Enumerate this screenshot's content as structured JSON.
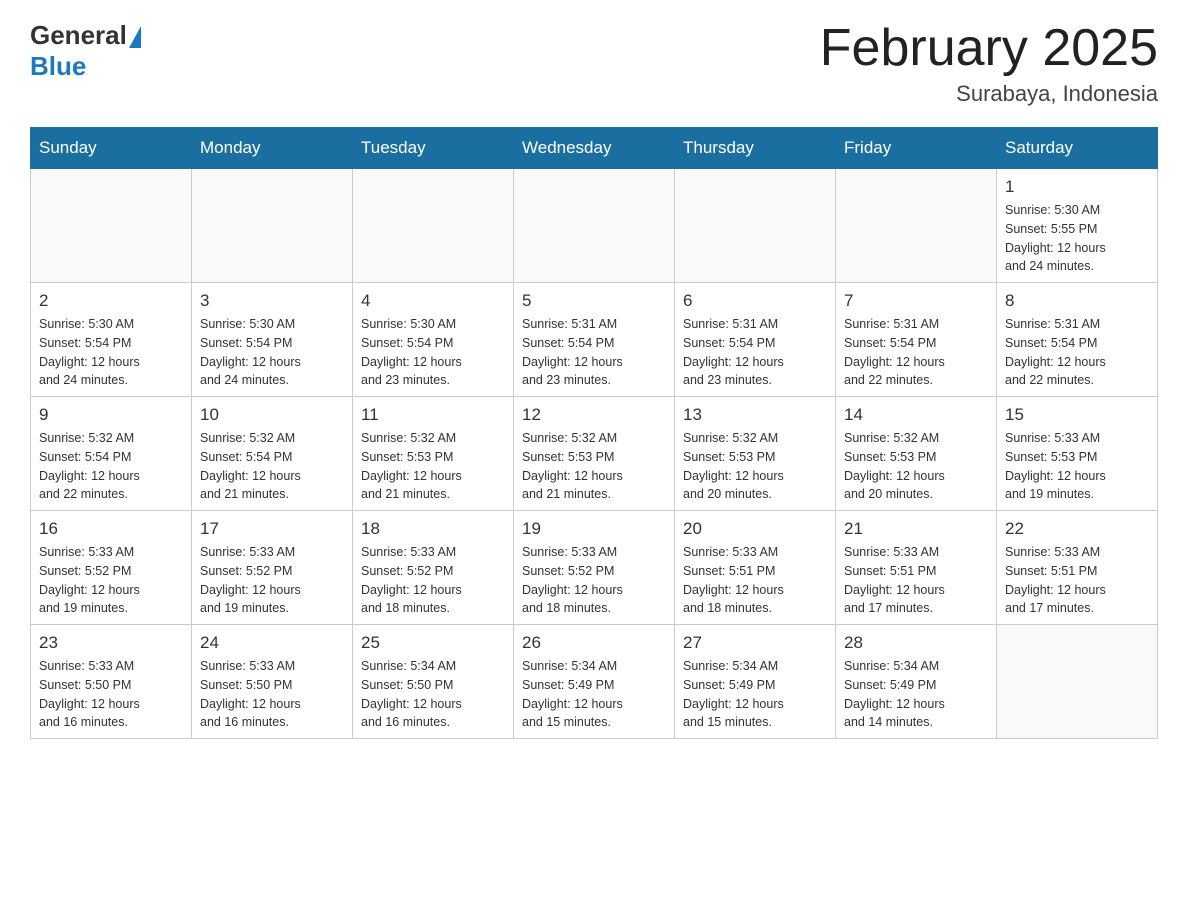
{
  "header": {
    "logo_general": "General",
    "logo_blue": "Blue",
    "month_title": "February 2025",
    "location": "Surabaya, Indonesia"
  },
  "weekdays": [
    "Sunday",
    "Monday",
    "Tuesday",
    "Wednesday",
    "Thursday",
    "Friday",
    "Saturday"
  ],
  "weeks": [
    [
      {
        "day": "",
        "info": ""
      },
      {
        "day": "",
        "info": ""
      },
      {
        "day": "",
        "info": ""
      },
      {
        "day": "",
        "info": ""
      },
      {
        "day": "",
        "info": ""
      },
      {
        "day": "",
        "info": ""
      },
      {
        "day": "1",
        "info": "Sunrise: 5:30 AM\nSunset: 5:55 PM\nDaylight: 12 hours\nand 24 minutes."
      }
    ],
    [
      {
        "day": "2",
        "info": "Sunrise: 5:30 AM\nSunset: 5:54 PM\nDaylight: 12 hours\nand 24 minutes."
      },
      {
        "day": "3",
        "info": "Sunrise: 5:30 AM\nSunset: 5:54 PM\nDaylight: 12 hours\nand 24 minutes."
      },
      {
        "day": "4",
        "info": "Sunrise: 5:30 AM\nSunset: 5:54 PM\nDaylight: 12 hours\nand 23 minutes."
      },
      {
        "day": "5",
        "info": "Sunrise: 5:31 AM\nSunset: 5:54 PM\nDaylight: 12 hours\nand 23 minutes."
      },
      {
        "day": "6",
        "info": "Sunrise: 5:31 AM\nSunset: 5:54 PM\nDaylight: 12 hours\nand 23 minutes."
      },
      {
        "day": "7",
        "info": "Sunrise: 5:31 AM\nSunset: 5:54 PM\nDaylight: 12 hours\nand 22 minutes."
      },
      {
        "day": "8",
        "info": "Sunrise: 5:31 AM\nSunset: 5:54 PM\nDaylight: 12 hours\nand 22 minutes."
      }
    ],
    [
      {
        "day": "9",
        "info": "Sunrise: 5:32 AM\nSunset: 5:54 PM\nDaylight: 12 hours\nand 22 minutes."
      },
      {
        "day": "10",
        "info": "Sunrise: 5:32 AM\nSunset: 5:54 PM\nDaylight: 12 hours\nand 21 minutes."
      },
      {
        "day": "11",
        "info": "Sunrise: 5:32 AM\nSunset: 5:53 PM\nDaylight: 12 hours\nand 21 minutes."
      },
      {
        "day": "12",
        "info": "Sunrise: 5:32 AM\nSunset: 5:53 PM\nDaylight: 12 hours\nand 21 minutes."
      },
      {
        "day": "13",
        "info": "Sunrise: 5:32 AM\nSunset: 5:53 PM\nDaylight: 12 hours\nand 20 minutes."
      },
      {
        "day": "14",
        "info": "Sunrise: 5:32 AM\nSunset: 5:53 PM\nDaylight: 12 hours\nand 20 minutes."
      },
      {
        "day": "15",
        "info": "Sunrise: 5:33 AM\nSunset: 5:53 PM\nDaylight: 12 hours\nand 19 minutes."
      }
    ],
    [
      {
        "day": "16",
        "info": "Sunrise: 5:33 AM\nSunset: 5:52 PM\nDaylight: 12 hours\nand 19 minutes."
      },
      {
        "day": "17",
        "info": "Sunrise: 5:33 AM\nSunset: 5:52 PM\nDaylight: 12 hours\nand 19 minutes."
      },
      {
        "day": "18",
        "info": "Sunrise: 5:33 AM\nSunset: 5:52 PM\nDaylight: 12 hours\nand 18 minutes."
      },
      {
        "day": "19",
        "info": "Sunrise: 5:33 AM\nSunset: 5:52 PM\nDaylight: 12 hours\nand 18 minutes."
      },
      {
        "day": "20",
        "info": "Sunrise: 5:33 AM\nSunset: 5:51 PM\nDaylight: 12 hours\nand 18 minutes."
      },
      {
        "day": "21",
        "info": "Sunrise: 5:33 AM\nSunset: 5:51 PM\nDaylight: 12 hours\nand 17 minutes."
      },
      {
        "day": "22",
        "info": "Sunrise: 5:33 AM\nSunset: 5:51 PM\nDaylight: 12 hours\nand 17 minutes."
      }
    ],
    [
      {
        "day": "23",
        "info": "Sunrise: 5:33 AM\nSunset: 5:50 PM\nDaylight: 12 hours\nand 16 minutes."
      },
      {
        "day": "24",
        "info": "Sunrise: 5:33 AM\nSunset: 5:50 PM\nDaylight: 12 hours\nand 16 minutes."
      },
      {
        "day": "25",
        "info": "Sunrise: 5:34 AM\nSunset: 5:50 PM\nDaylight: 12 hours\nand 16 minutes."
      },
      {
        "day": "26",
        "info": "Sunrise: 5:34 AM\nSunset: 5:49 PM\nDaylight: 12 hours\nand 15 minutes."
      },
      {
        "day": "27",
        "info": "Sunrise: 5:34 AM\nSunset: 5:49 PM\nDaylight: 12 hours\nand 15 minutes."
      },
      {
        "day": "28",
        "info": "Sunrise: 5:34 AM\nSunset: 5:49 PM\nDaylight: 12 hours\nand 14 minutes."
      },
      {
        "day": "",
        "info": ""
      }
    ]
  ]
}
